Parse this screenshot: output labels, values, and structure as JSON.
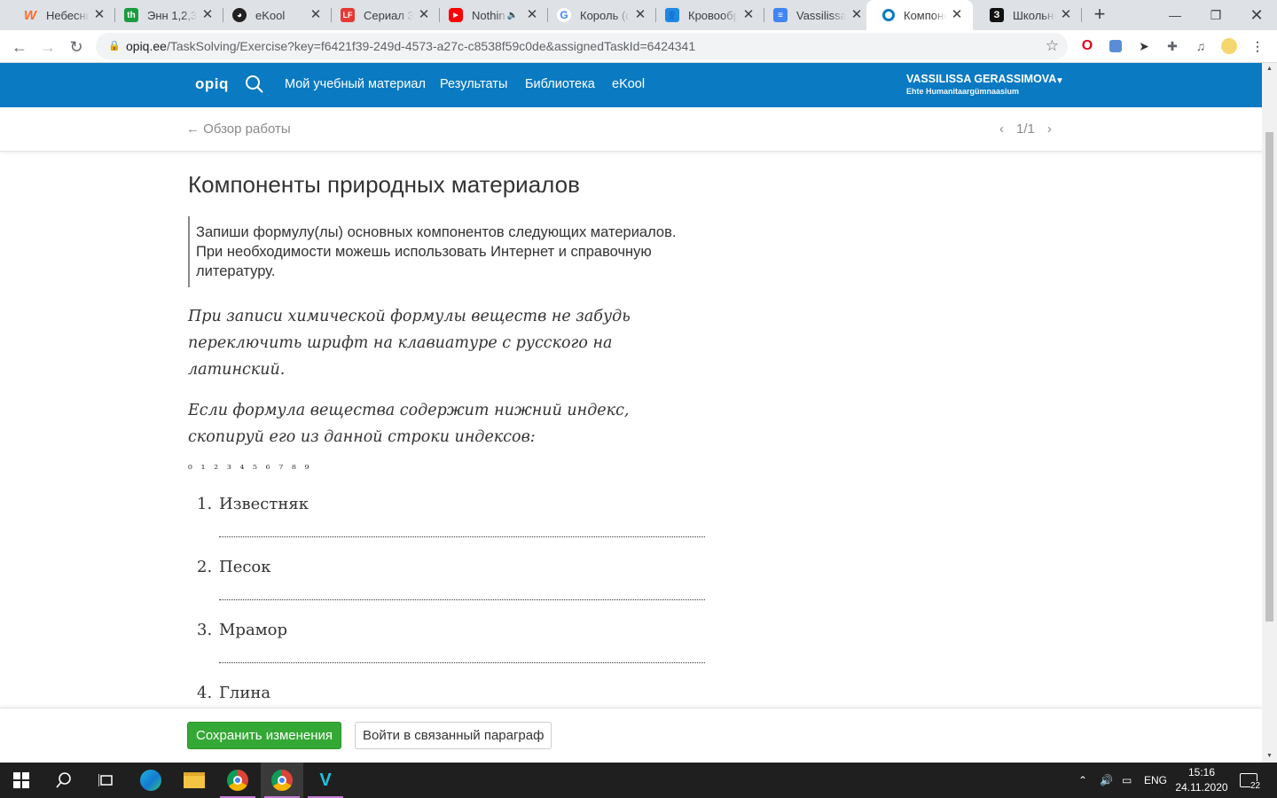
{
  "browser": {
    "tabs": [
      {
        "title": "Небесный",
        "favicon": "W",
        "color": "#ff6a2b"
      },
      {
        "title": "Энн 1,2,3",
        "favicon": "th",
        "color": "#1a9b3f"
      },
      {
        "title": "eKool",
        "favicon": "mask",
        "color": "#222222"
      },
      {
        "title": "Сериал За",
        "favicon": "LF",
        "color": "#e53935"
      },
      {
        "title": "Nothin",
        "favicon": "yt",
        "color": "#ff0000"
      },
      {
        "title": "Король (ф",
        "favicon": "G",
        "color": "#4285f4"
      },
      {
        "title": "Кровообр",
        "favicon": "cls",
        "color": "#1e88e5"
      },
      {
        "title": "Vassilissa C",
        "favicon": "doc",
        "color": "#4285f4"
      },
      {
        "title": "Компонен",
        "favicon": "opiq",
        "color": "#0a7ac2"
      },
      {
        "title": "Школьны",
        "favicon": "З",
        "color": "#111111"
      }
    ],
    "active_tab": 8,
    "url_host": "opiq.ee",
    "url_path": "/TaskSolving/Exercise?key=f6421f39-249d-4573-a27c-c8538f59c0de&assignedTaskId=6424341"
  },
  "app": {
    "logo": "opiq",
    "nav": [
      "Мой учебный материал",
      "Результаты",
      "Библиотека",
      "eKool"
    ],
    "user_name": "VASSILISSA GERASSIMOVA",
    "user_school": "Ehte Humanitaargümnaasium",
    "back_label": "Обзор работы",
    "pager": "1/1"
  },
  "exercise": {
    "title": "Компоненты природных материалов",
    "instruction": "Запиши формулу(лы) основных компонентов следующих материалов. При необходимости можешь использовать Интернет и справочную литературу.",
    "note1": "При записи химической формулы веществ не забудь переключить шрифт на клавиатуре с русского на латинский.",
    "note2": "Если формула вещества содержит нижний индекс, скопируй его из данной строки индексов:",
    "indices": "₀ ₁ ₂ ₃ ₄ ₅ ₆ ₇ ₈ ₉",
    "items": [
      {
        "num": "1.",
        "label": "Известняк",
        "answer": ""
      },
      {
        "num": "2.",
        "label": "Песок",
        "answer": ""
      },
      {
        "num": "3.",
        "label": "Мрамор",
        "answer": ""
      },
      {
        "num": "4.",
        "label": "Глина",
        "answer": ""
      }
    ]
  },
  "footer": {
    "save_label": "Сохранить изменения",
    "paragraph_label": "Войти в связанный параграф"
  },
  "taskbar": {
    "lang": "ENG",
    "time": "15:16",
    "date": "24.11.2020",
    "notifications": "22"
  }
}
